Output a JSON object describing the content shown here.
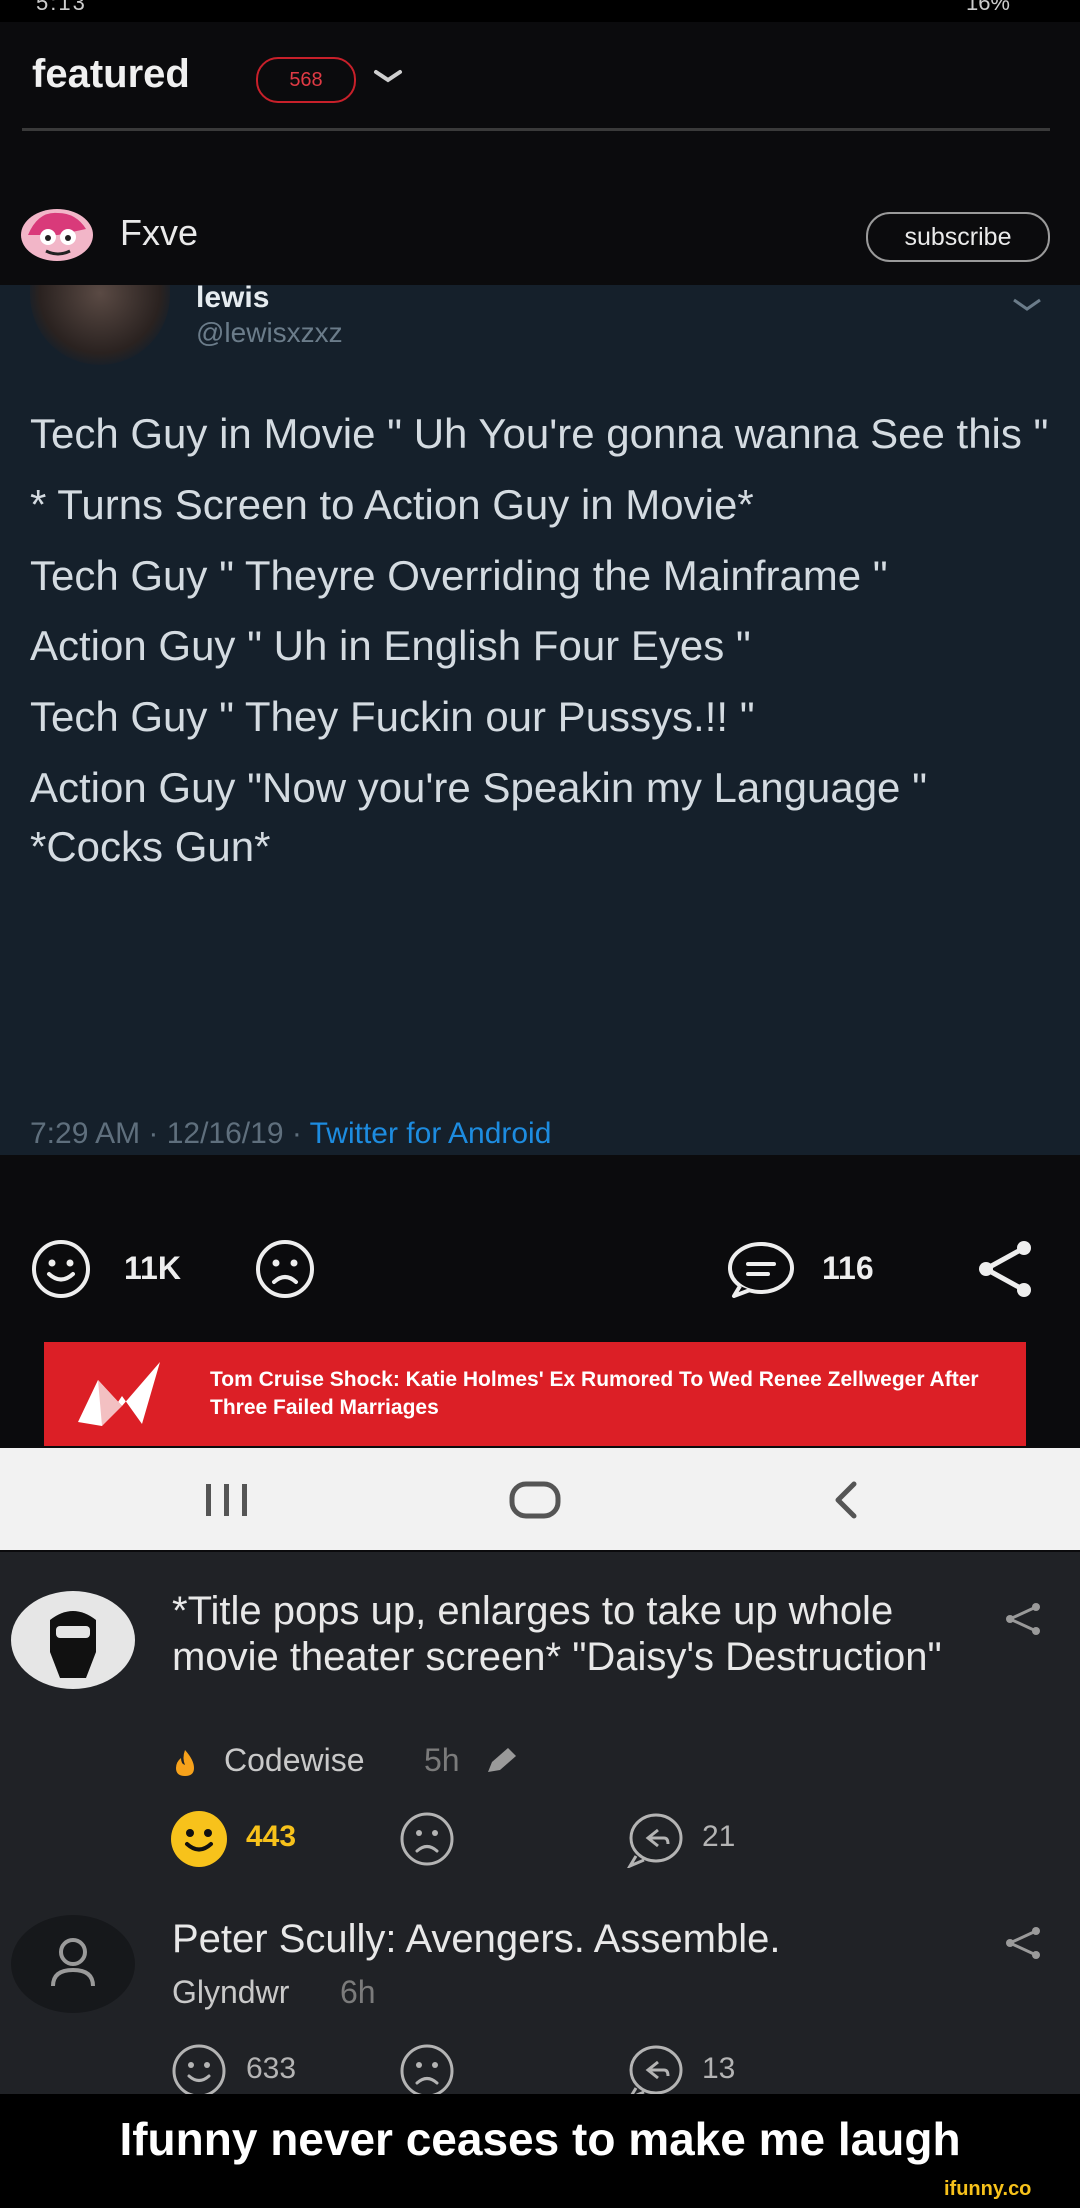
{
  "status_bar": {
    "time": "5:13",
    "battery": "16%"
  },
  "header": {
    "feed_name": "featured",
    "badge_count": "568"
  },
  "post": {
    "author": "Fxve",
    "subscribe_label": "subscribe",
    "tweet": {
      "display_name": "lewis",
      "handle": "@lewisxzxz",
      "lines": [
        "Tech Guy in Movie  \" Uh  You're gonna wanna See this \"",
        "* Turns Screen to Action Guy in Movie*",
        "Tech Guy \" Theyre Overriding the Mainframe \"",
        "Action Guy \" Uh  in English Four Eyes \"",
        "Tech Guy \" They Fuckin our Pussys.!! \"",
        "Action Guy \"Now you're Speakin my Language \"  *Cocks Gun*"
      ],
      "meta": "7:29 AM · 12/16/19 · ",
      "source": "Twitter for Android"
    },
    "smiles": "11K",
    "comments_count": "116"
  },
  "ad": {
    "text": "Tom Cruise Shock: Katie Holmes' Ex Rumored To Wed Renee Zellweger After Three Failed Marriages"
  },
  "comments": [
    {
      "text": "*Title pops up, enlarges to take up whole movie theater screen* \"Daisy's Destruction\"",
      "username": "Codewise",
      "time": "5h",
      "smiles": "443",
      "replies": "21"
    },
    {
      "text": "Peter Scully: Avengers. Assemble.",
      "username": "Glyndwr",
      "time": "6h",
      "smiles": "633",
      "replies": "13"
    }
  ],
  "caption": "Ifunny never ceases to make me laugh",
  "watermark": "ifunny.co",
  "colors": {
    "accent_red": "#dc1f26",
    "smile_yellow": "#f7c21b",
    "twitter_bg": "#15202b",
    "twitter_link": "#1d8ce0"
  }
}
